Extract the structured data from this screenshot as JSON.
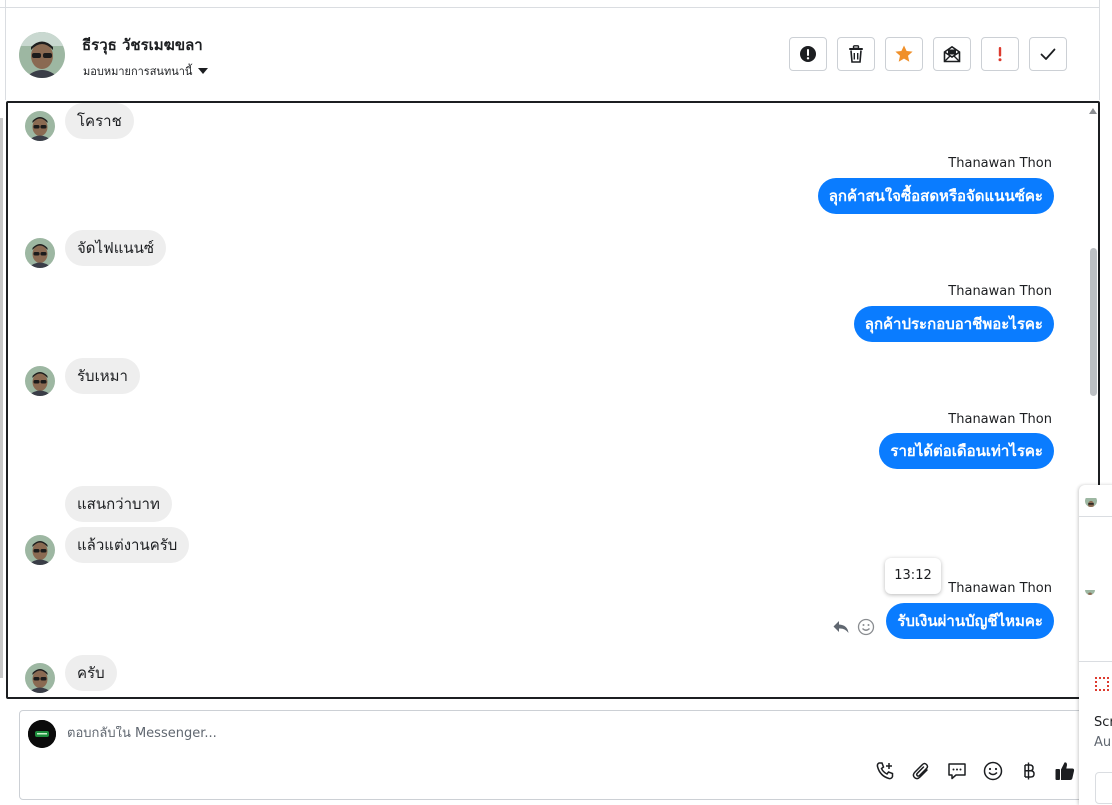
{
  "header": {
    "contact_name": "ธีรวุธ วัชรเมฆขลา",
    "assign_label": "มอบหมายการสนทนานี้",
    "toolbar": [
      {
        "name": "spam-button",
        "icon": "alert-circle-icon"
      },
      {
        "name": "delete-button",
        "icon": "trash-icon"
      },
      {
        "name": "star-button",
        "icon": "star-icon"
      },
      {
        "name": "mark-unread-button",
        "icon": "envelope-open-icon"
      },
      {
        "name": "follow-up-button",
        "icon": "exclamation-icon"
      },
      {
        "name": "mark-done-button",
        "icon": "check-icon"
      }
    ]
  },
  "messages": [
    {
      "dir": "in",
      "text": "โคราช",
      "avatar": true
    },
    {
      "dir": "out",
      "sender": "Thanawan Thon",
      "text": "ลุกค้าสนใจซื้อสดหรือจัดแนนซ์คะ"
    },
    {
      "dir": "in",
      "text": "จัดไฟแนนซ์",
      "avatar": true
    },
    {
      "dir": "out",
      "sender": "Thanawan Thon",
      "text": "ลุกค้าประกอบอาชีพอะไรคะ"
    },
    {
      "dir": "in",
      "text": "รับเหมา",
      "avatar": true
    },
    {
      "dir": "out",
      "sender": "Thanawan Thon",
      "text": "รายได้ต่อเดือนเท่าไรคะ"
    },
    {
      "dir": "in",
      "text": "แสนกว่าบาท",
      "avatar": false
    },
    {
      "dir": "in",
      "text": "แล้วแต่งานครับ",
      "avatar": true
    },
    {
      "dir": "out",
      "sender": "Thanawan Thon",
      "text": "รับเงินผ่านบัญชีไหมคะ",
      "hover_time": "13:12"
    },
    {
      "dir": "in",
      "text": "ครับ",
      "avatar": true
    }
  ],
  "reply": {
    "placeholder": "ตอบกลับใน Messenger..."
  },
  "reply_icons": [
    "phone-add-icon",
    "paperclip-icon",
    "saved-reply-icon",
    "emoji-icon",
    "baht-icon",
    "thumbs-up-icon"
  ],
  "side_panel": {
    "text1": "Scr",
    "text2": "Au"
  },
  "colors": {
    "accent": "#0a7cff",
    "incoming_bubble": "#eeeeee",
    "star": "#f0902a",
    "alert": "#dd3b2f"
  }
}
